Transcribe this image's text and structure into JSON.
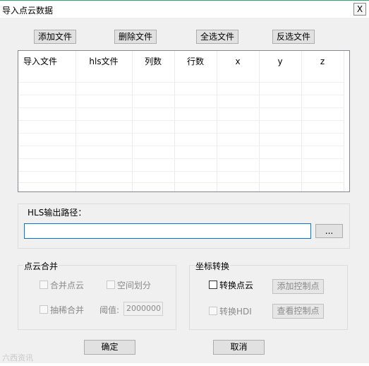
{
  "window": {
    "title": "导入点云数据",
    "close_label": "X"
  },
  "toolbar": {
    "add_files": "添加文件",
    "delete_files": "删除文件",
    "select_all": "全选文件",
    "invert_selection": "反选文件"
  },
  "table": {
    "columns": [
      "导入文件",
      "hls文件",
      "列数",
      "行数",
      "x",
      "y",
      "z"
    ],
    "rows": []
  },
  "hls_output": {
    "label": "HLS输出路径：",
    "path_value": "",
    "browse_label": "..."
  },
  "merge_group": {
    "title": "点云合并",
    "merge_points_label": "合并点云",
    "spatial_partition_label": "空间划分",
    "sparse_merge_label": "抽稀合并",
    "threshold_label": "阈值:",
    "threshold_value": "2000000"
  },
  "coord_group": {
    "title": "坐标转换",
    "convert_points_label": "转换点云",
    "add_control_points_label": "添加控制点",
    "convert_hdi_label": "转换HDI",
    "view_control_points_label": "查看控制点"
  },
  "footer": {
    "ok_label": "确定",
    "cancel_label": "取消"
  },
  "watermark": "六西资讯"
}
